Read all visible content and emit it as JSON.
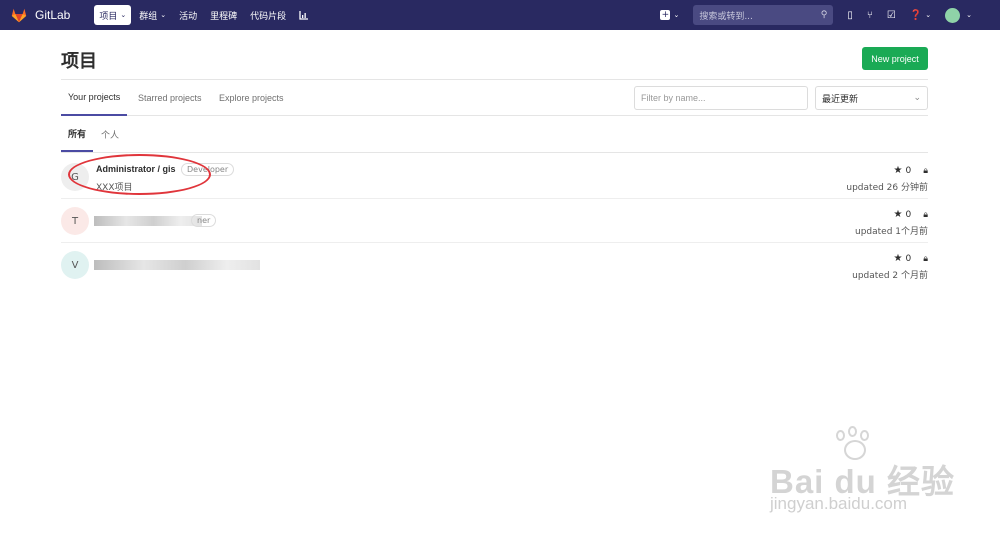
{
  "topbar": {
    "brand": "GitLab",
    "nav": [
      {
        "label": "项目",
        "dropdown": true,
        "active": true
      },
      {
        "label": "群组",
        "dropdown": true,
        "active": false
      },
      {
        "label": "活动",
        "dropdown": false,
        "active": false
      },
      {
        "label": "里程碑",
        "dropdown": false,
        "active": false
      },
      {
        "label": "代码片段",
        "dropdown": false,
        "active": false
      }
    ],
    "search_placeholder": "搜索或转到..."
  },
  "page": {
    "title": "项目",
    "new_project_label": "New project"
  },
  "tabs": [
    "Your projects",
    "Starred projects",
    "Explore projects"
  ],
  "filter_placeholder": "Filter by name...",
  "sort_label": "最近更新",
  "subtabs": [
    "所有",
    "个人"
  ],
  "projects": [
    {
      "initial": "G",
      "name": "Administrator / gis",
      "role": "Developer",
      "description": "XXX项目",
      "stars": "0",
      "updated": "updated 26 分钟前",
      "avatar_color": "#eeeeee"
    },
    {
      "initial": "T",
      "name": "",
      "role": "ner",
      "description": "",
      "stars": "0",
      "updated": "updated 1个月前",
      "avatar_color": "#fbe9e7"
    },
    {
      "initial": "V",
      "name": "",
      "role": "",
      "description": "",
      "stars": "0",
      "updated": "updated 2 个月前",
      "avatar_color": "#e0f2f1"
    }
  ],
  "watermark": {
    "text": "Bai du 经验",
    "url": "jingyan.baidu.com"
  },
  "colors": {
    "nav_bg": "#292961",
    "primary_button": "#1aaa55",
    "active_tab": "#4b4ba3"
  }
}
